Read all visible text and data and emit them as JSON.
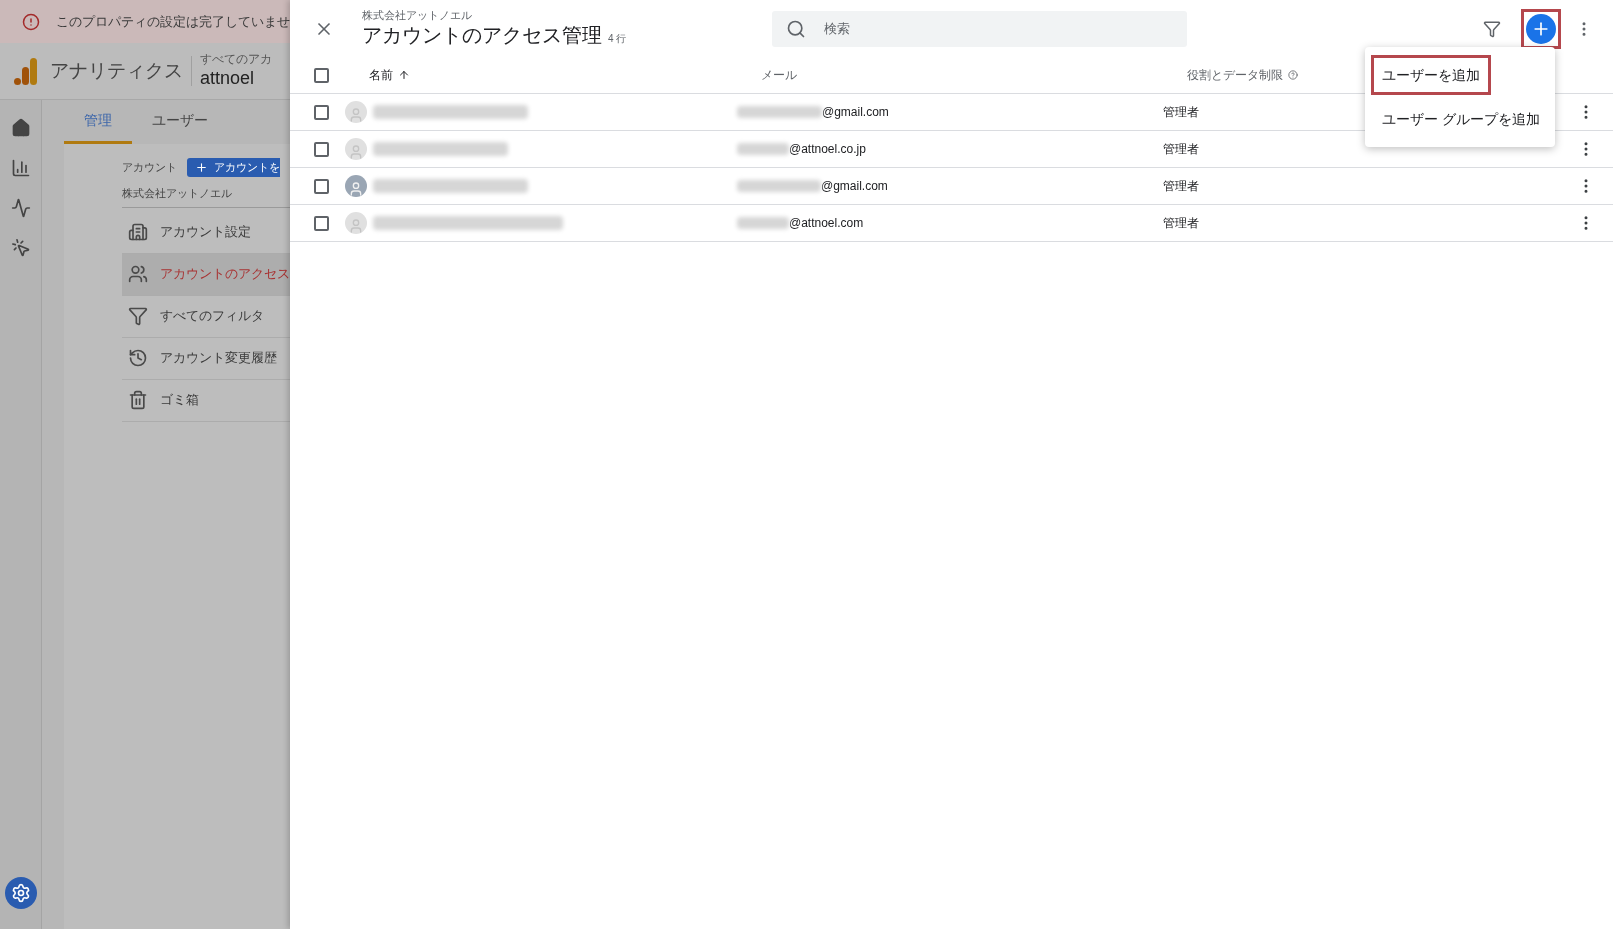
{
  "banner": {
    "text": "このプロパティの設定は完了していませ"
  },
  "app": {
    "name": "アナリティクス",
    "account_label": "すべてのアカ",
    "account_name": "attnoel"
  },
  "admin_tabs": [
    {
      "label": "管理",
      "selected": true
    },
    {
      "label": "ユーザー",
      "selected": false
    }
  ],
  "account": {
    "label": "アカウント",
    "create_button": "アカウントを",
    "name": "株式会社アットノエル"
  },
  "account_menu": [
    {
      "kind": "building",
      "label": "アカウント設定",
      "selected": false
    },
    {
      "kind": "people",
      "label": "アカウントのアクセス",
      "selected": true
    },
    {
      "kind": "filter",
      "label": "すべてのフィルタ",
      "selected": false
    },
    {
      "kind": "history",
      "label": "アカウント変更履歴",
      "selected": false
    },
    {
      "kind": "trash",
      "label": "ゴミ箱",
      "selected": false
    }
  ],
  "panel": {
    "subtitle": "株式会社アットノエル",
    "title": "アカウントのアクセス管理",
    "count": "4 行",
    "search": {
      "placeholder": "検索"
    },
    "add_button_highlighted": true
  },
  "table": {
    "columns": [
      {
        "label": "名前",
        "sorted": true,
        "help": false
      },
      {
        "label": "メール",
        "sorted": false,
        "help": false
      },
      {
        "label": "役割とデータ制限",
        "sorted": false,
        "help": true
      }
    ],
    "all_checked": false,
    "rows": [
      {
        "avatar_photo": false,
        "email_domain": "@gmail.com",
        "role": "管理者",
        "checked": false
      },
      {
        "avatar_photo": false,
        "email_domain": "@attnoel.co.jp",
        "role": "管理者",
        "checked": false
      },
      {
        "avatar_photo": true,
        "email_domain": "@gmail.com",
        "role": "管理者",
        "checked": false
      },
      {
        "avatar_photo": false,
        "email_domain": "@attnoel.com",
        "role": "管理者",
        "checked": false
      }
    ]
  },
  "add_menu": [
    {
      "label": "ユーザーを追加",
      "highlighted": true
    },
    {
      "label": "ユーザー グループを追加",
      "highlighted": false
    }
  ]
}
